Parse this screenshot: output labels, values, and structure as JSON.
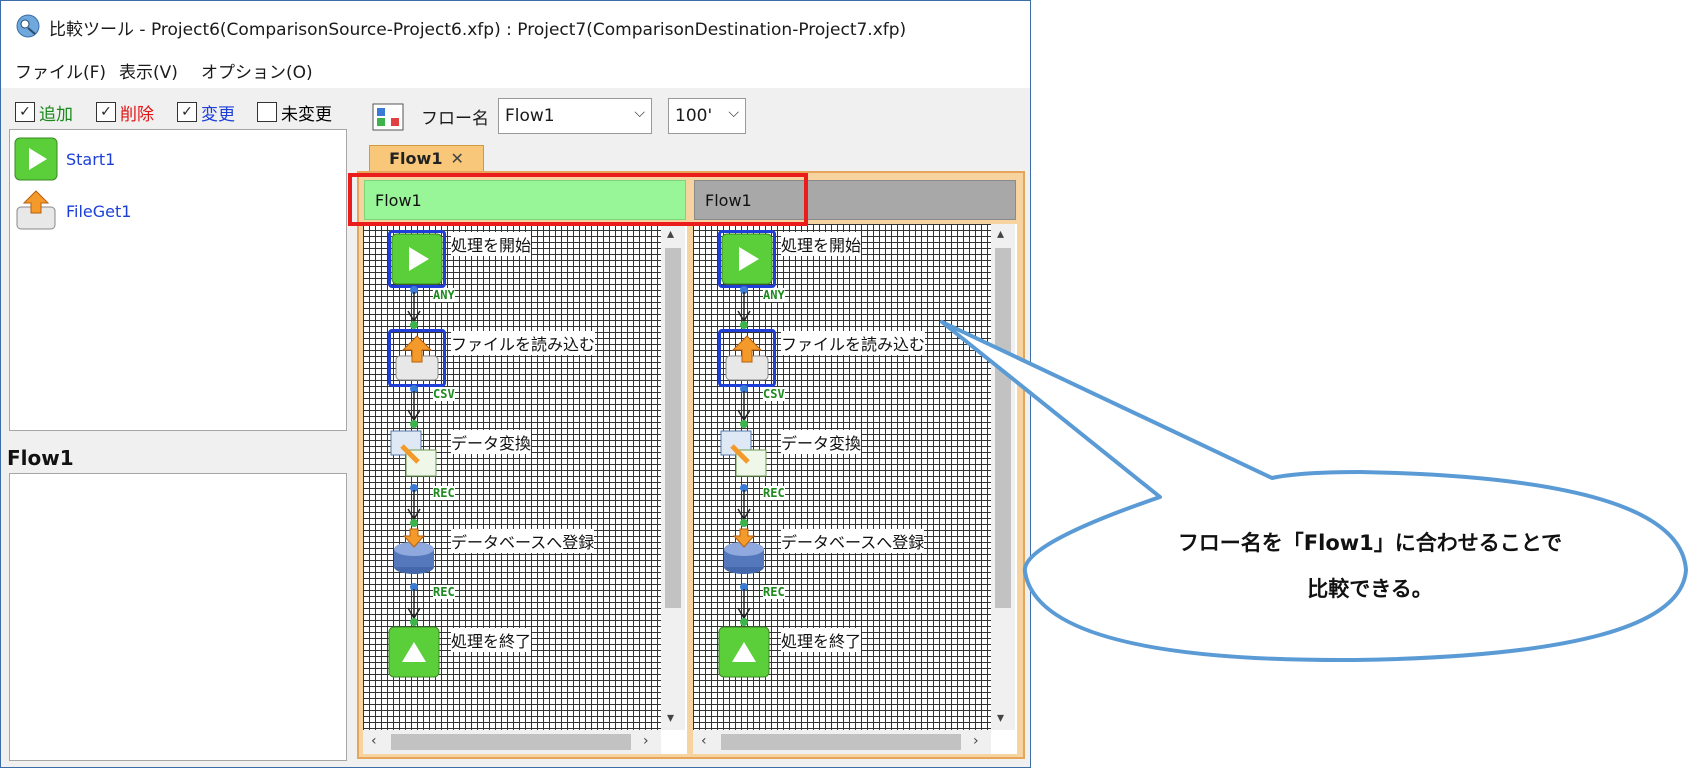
{
  "window": {
    "title": "比較ツール - Project6(ComparisonSource-Project6.xfp) : Project7(ComparisonDestination-Project7.xfp)"
  },
  "menu": [
    "ファイル(F)",
    "表示(V)",
    "オプション(O)"
  ],
  "filters": [
    {
      "label": "追加",
      "checked": true,
      "color": "#1a8a1a"
    },
    {
      "label": "削除",
      "checked": true,
      "color": "#e01515"
    },
    {
      "label": "変更",
      "checked": true,
      "color": "#1b3fd8"
    },
    {
      "label": "未変更",
      "checked": false,
      "color": "#1a1a1a"
    }
  ],
  "nodes": [
    {
      "label": "Start1",
      "icon": "start-play-icon"
    },
    {
      "label": "FileGet1",
      "icon": "file-upload-icon"
    }
  ],
  "detail_title": "Flow1",
  "toolbar": {
    "flowname_label": "フロー名",
    "flow_select": "Flow1",
    "zoom": "100'"
  },
  "tab": {
    "label": "Flow1",
    "close": "✕"
  },
  "panels": [
    {
      "header": "Flow1",
      "header_color": "#98f598",
      "steps": [
        {
          "label": "処理を開始",
          "icon": "start-play-icon"
        },
        {
          "label": "ファイルを読み込む",
          "icon": "file-upload-icon"
        },
        {
          "label": "データ変換",
          "icon": "data-convert-icon"
        },
        {
          "label": "データベースへ登録",
          "icon": "database-register-icon"
        },
        {
          "label": "処理を終了",
          "icon": "end-stop-icon"
        }
      ],
      "connectors": [
        "ANY",
        "CSV",
        "REC",
        "REC"
      ]
    },
    {
      "header": "Flow1",
      "header_color": "#a8a8a8",
      "steps": [
        {
          "label": "処理を開始",
          "icon": "start-play-icon"
        },
        {
          "label": "ファイルを読み込む",
          "icon": "file-upload-icon"
        },
        {
          "label": "データ変換",
          "icon": "data-convert-icon"
        },
        {
          "label": "データベースへ登録",
          "icon": "database-register-icon"
        },
        {
          "label": "処理を終了",
          "icon": "end-stop-icon"
        }
      ],
      "connectors": [
        "ANY",
        "CSV",
        "REC",
        "REC"
      ]
    }
  ],
  "callout": {
    "line1": "フロー名を「Flow1」に合わせることで",
    "line2": "比較できる。"
  },
  "colors": {
    "highlight_box": "#ea1c1c",
    "callout_stroke": "#5b9bd5",
    "selection": "#1f3ed8"
  }
}
